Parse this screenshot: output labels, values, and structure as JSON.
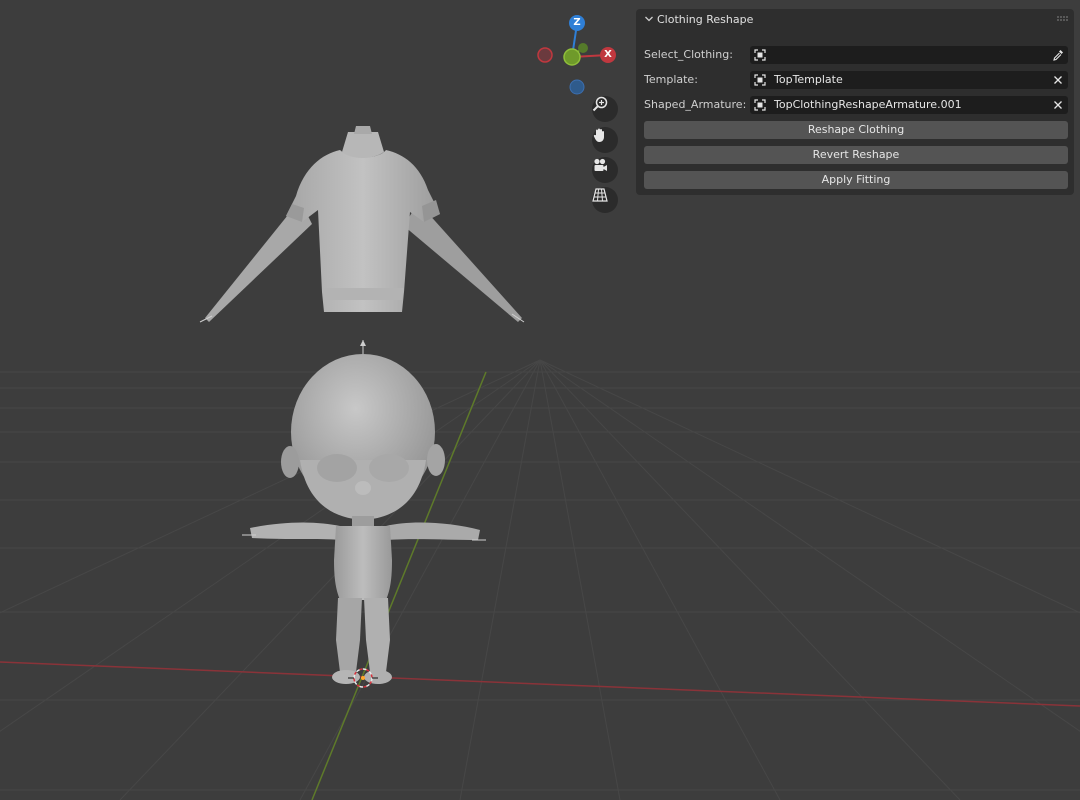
{
  "gizmo": {
    "z_label": "Z",
    "x_label": "X"
  },
  "nav": {
    "icons": [
      "zoom-icon",
      "pan-hand-icon",
      "camera-icon",
      "grid-perspective-icon"
    ]
  },
  "panel": {
    "title": "Clothing Reshape",
    "fields": [
      {
        "label": "Select_Clothing:",
        "value": "",
        "end_icon": "eyedropper-icon"
      },
      {
        "label": "Template:",
        "value": "TopTemplate",
        "end_icon": "close-icon"
      },
      {
        "label": "Shaped_Armature:",
        "value": "TopClothingReshapeArmature.001",
        "end_icon": "close-icon"
      }
    ],
    "buttons": [
      "Reshape Clothing",
      "Revert Reshape",
      "Apply Fitting"
    ]
  },
  "colors": {
    "viewport_bg": "#3d3d3d",
    "x_axis": "#c0383f",
    "y_axis": "#6f9a2a",
    "z_axis": "#2f7fd6",
    "panel_bg": "#2e2e2e",
    "button_bg": "#545454"
  }
}
